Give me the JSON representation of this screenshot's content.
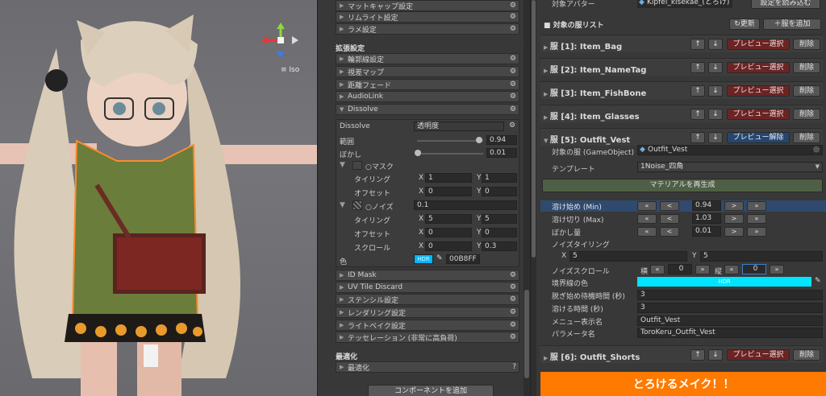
{
  "scene": {
    "iso_label": "Iso",
    "gizmo_axes": [
      "x",
      "y",
      "z"
    ],
    "icons": {
      "gizmo": "axis-gizmo-icon"
    }
  },
  "middle": {
    "sections_top": [
      "マットキャップ設定",
      "リムライト設定",
      "ラメ設定"
    ],
    "extended_header": "拡張設定",
    "sections_ext": [
      "輪郭線設定",
      "視差マップ",
      "距離フェード",
      "AudioLink"
    ],
    "dissolve_section": "Dissolve",
    "dissolve": {
      "label": "Dissolve",
      "mode": "透明度",
      "range_label": "範囲",
      "range_value": "0.94",
      "range_fraction": 0.94,
      "blur_label": "ぼかし",
      "blur_value": "0.01",
      "blur_fraction": 0.01,
      "mask_label": "○マスク",
      "tiling_label": "タイリング",
      "offset_label": "オフセット",
      "mask_tiling_x": "1",
      "mask_tiling_y": "1",
      "mask_offset_x": "0",
      "mask_offset_y": "0",
      "noise_label": "○ノイズ",
      "noise_value": "0.1",
      "noise_tiling_x": "5",
      "noise_tiling_y": "5",
      "noise_offset_x": "0",
      "noise_offset_y": "0",
      "scroll_label": "スクロール",
      "scroll_x": "0",
      "scroll_y": "0.3",
      "color_label": "色",
      "color_hdr": "HDR",
      "color_hex": "00B8FF",
      "x_letter": "X",
      "y_letter": "Y"
    },
    "sections_bottom": [
      "ID Mask",
      "UV Tile Discard",
      "ステンシル設定",
      "レンダリング設定",
      "ライトベイク設定",
      "テッセレーション (非常に高負荷)"
    ],
    "optimize_header": "最適化",
    "optimize_item": "最適化",
    "add_component": "コンポーネントを追加"
  },
  "right": {
    "avatar_label": "対象アバター",
    "avatar_value": "Kipfel_kisekae_(とろけ)",
    "load_settings": "設定を読み込む",
    "list_title": "■ 対象の服リスト",
    "refresh": "↻更新",
    "add_clothes": "＋服を追加",
    "up": "↑",
    "down": "↓",
    "preview_select": "プレビュー選択",
    "preview_cancel": "プレビュー解除",
    "delete": "削除",
    "items": [
      {
        "title": "服 [1]: Item_Bag"
      },
      {
        "title": "服 [2]: Item_NameTag"
      },
      {
        "title": "服 [3]: Item_FishBone"
      },
      {
        "title": "服 [4]: Item_Glasses"
      },
      {
        "title": "服 [5]: Outfit_Vest"
      },
      {
        "title": "服 [6]: Outfit_Shorts"
      }
    ],
    "vest": {
      "target_label": "対象の服 (GameObject)",
      "target_value": "Outfit_Vest",
      "template_label": "テンプレート",
      "template_value": "1Noise_四角",
      "regen": "マテリアルを再生成",
      "melt_start_label": "溶け始め (Min)",
      "melt_start_value": "0.94",
      "melt_end_label": "溶け切り (Max)",
      "melt_end_value": "1.03",
      "blur_label": "ぼかし量",
      "blur_value": "0.01",
      "noise_tiling_label": "ノイズタイリング",
      "noise_tiling_x": "5",
      "noise_tiling_y": "5",
      "noise_scroll_label": "ノイズスクロール",
      "horiz_label": "横",
      "vert_label": "縦",
      "scroll_h": "0",
      "scroll_v": "0",
      "edge_color_label": "境界線の色",
      "edge_hdr": "HDR",
      "undress_wait_label": "脱ぎ始め待機時間 (秒)",
      "undress_wait_value": "3",
      "melt_time_label": "溶ける時間 (秒)",
      "melt_time_value": "3",
      "menu_name_label": "メニュー表示名",
      "menu_name_value": "Outfit_Vest",
      "param_label": "パラメータ名",
      "param_value": "ToroKeru_Outfit_Vest",
      "step_ll": "«",
      "step_l": "<",
      "step_r": ">",
      "step_rr": "»"
    },
    "big_button": "とろけるメイク！！",
    "colors": {
      "accent": "#ff7a00",
      "edge": "#00e5ff",
      "dissolve": "#00B8FF"
    }
  }
}
